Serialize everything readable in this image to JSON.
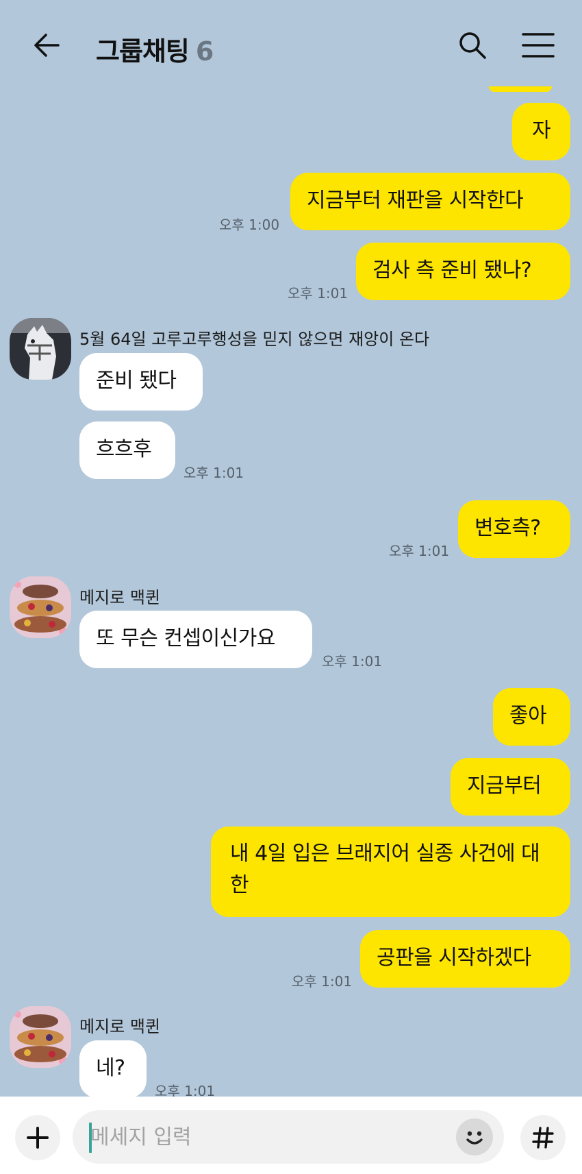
{
  "header": {
    "title": "그룹채팅",
    "member_count": "6"
  },
  "messages": [
    {
      "from": "me",
      "text": "자"
    },
    {
      "from": "me",
      "text": "지금부터 재판을 시작한다",
      "time": "오후 1:00"
    },
    {
      "from": "me",
      "text": "검사 측 준비 됐나?",
      "time": "오후 1:01"
    },
    {
      "from": "other",
      "sender": "5월 64일 고루고루행성을 믿지 않으면 재앙이 온다",
      "avatar": "white-horse-avatar",
      "text": "준비 됐다"
    },
    {
      "from": "other",
      "text": "흐흐후",
      "time": "오후 1:01"
    },
    {
      "from": "me",
      "text": "변호측?",
      "time": "오후 1:01"
    },
    {
      "from": "other",
      "sender": "메지로 맥퀸",
      "avatar": "dessert-tray-avatar",
      "text": "또 무슨 컨셉이신가요",
      "time": "오후 1:01"
    },
    {
      "from": "me",
      "text": "좋아"
    },
    {
      "from": "me",
      "text": "지금부터"
    },
    {
      "from": "me",
      "text": "내 4일 입은 브래지어 실종 사건에 대한"
    },
    {
      "from": "me",
      "text": "공판을 시작하겠다",
      "time": "오후 1:01"
    },
    {
      "from": "other",
      "sender": "메지로 맥퀸",
      "avatar": "dessert-tray-avatar",
      "text": "네?",
      "time": "오후 1:01"
    }
  ],
  "input": {
    "placeholder": "메세지 입력"
  },
  "colors": {
    "background": "#b2c7da",
    "my_bubble": "#fee500",
    "other_bubble": "#ffffff"
  }
}
